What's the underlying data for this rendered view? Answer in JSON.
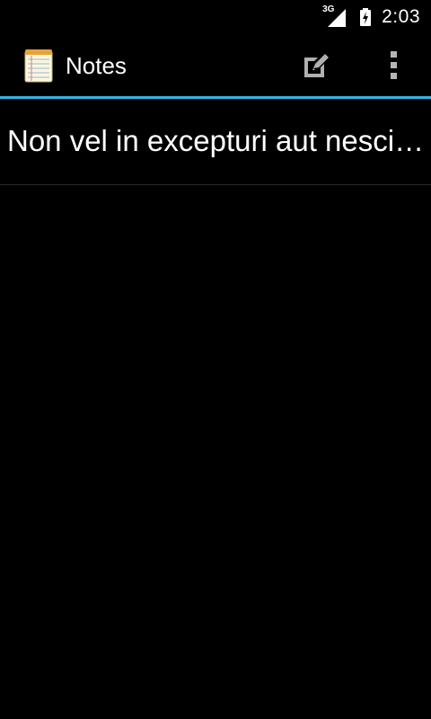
{
  "status_bar": {
    "network": "3G",
    "time": "2:03"
  },
  "action_bar": {
    "title": "Notes",
    "accent_color": "#33b5e5",
    "icons": {
      "app": "notepad-icon",
      "new_note": "edit-note-icon",
      "overflow": "overflow-menu-icon"
    }
  },
  "notes": [
    {
      "title": "Non vel in excepturi aut nesciunt"
    }
  ]
}
